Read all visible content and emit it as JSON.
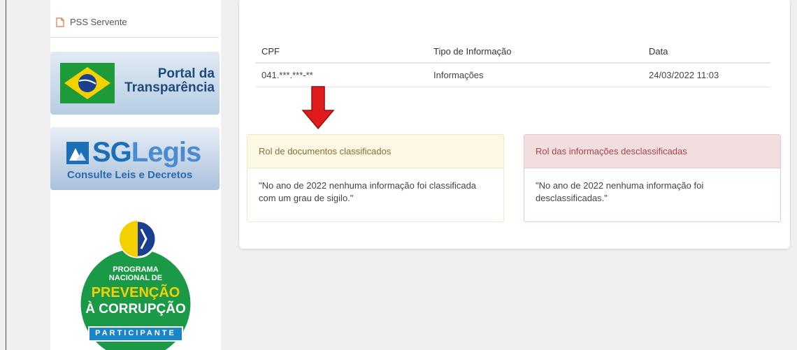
{
  "sidebar": {
    "link_label": "PSS Servente",
    "portal_line1": "Portal da",
    "portal_line2": "Transparência",
    "sg_title_sg": "SG",
    "sg_title_legis": "Legis",
    "sg_subtitle": "Consulte Leis e Decretos",
    "seal_line1": "PROGRAMA",
    "seal_line2": "NACIONAL DE",
    "seal_line3": "PREVENÇÃO",
    "seal_line4": "À CORRUPÇÃO",
    "seal_ribbon": "PARTICIPANTE"
  },
  "table": {
    "headers": [
      "CPF",
      "Tipo de Informação",
      "Data"
    ],
    "rows": [
      [
        "041.***.***-**",
        "Informações",
        "24/03/2022 11:03"
      ]
    ]
  },
  "panels": {
    "classified": {
      "title": "Rol de documentos classificados",
      "text": "\"No ano de 2022 nenhuma informação foi classificada com um grau de sigilo.\""
    },
    "declassified": {
      "title": "Rol das informações desclassificadas",
      "text": "\"No ano de 2022 nenhuma informação foi desclassificadas.\""
    }
  },
  "colors": {
    "arrow": "#e01b1b",
    "warning_bg": "#fcf8e3",
    "danger_bg": "#f2dede",
    "seal_green": "#1a9a46"
  }
}
